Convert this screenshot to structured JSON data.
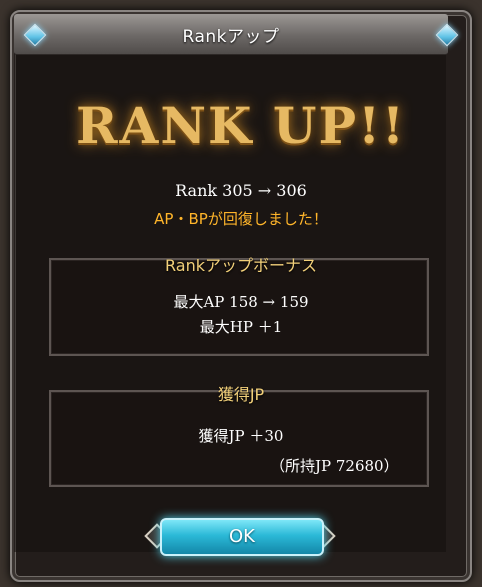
{
  "dialog": {
    "title": "Rankアップ",
    "headline": "RANK UP!!",
    "rank_line": "Rank 305 → 306",
    "recover_line": "AP・BPが回復しました！",
    "bonus": {
      "title": "Rankアップボーナス",
      "lines": [
        "最大AP 158 → 159",
        "最大HP ＋1"
      ]
    },
    "jp": {
      "title": "獲得JP",
      "gain": "獲得JP ＋30",
      "total": "（所持JP 72680）"
    },
    "ok_label": "OK"
  },
  "colors": {
    "gold_text": "#f2d07a",
    "orange_text": "#ffb52a",
    "ok_button": "#2bb9d7"
  }
}
